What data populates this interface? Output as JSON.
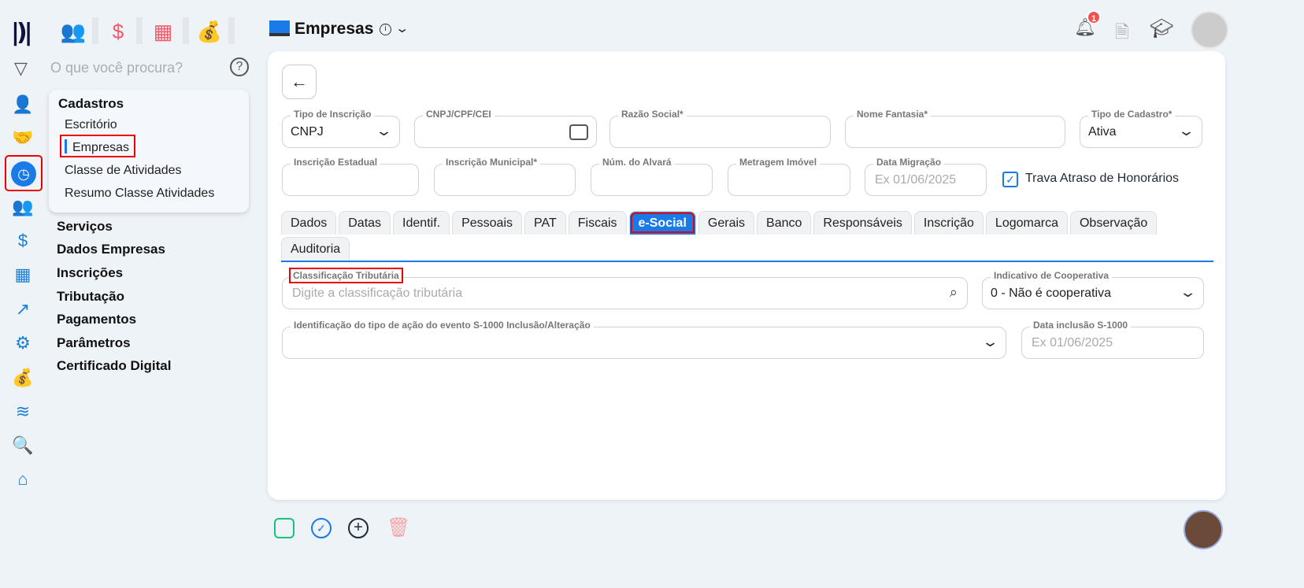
{
  "logo_text": "M",
  "top_icons": [
    "users-icon",
    "dollar-icon",
    "calculator-icon",
    "money-bag-icon"
  ],
  "search": {
    "placeholder": "O que você procura?"
  },
  "side_icons": [
    "user-gear-icon",
    "handshake-icon",
    "clock-icon",
    "users-icon",
    "dollar-circle-icon",
    "calculator-icon",
    "chart-arrow-icon",
    "gear-icon",
    "money-bag-icon",
    "layers-icon",
    "search-icon",
    "home-icon"
  ],
  "submenu": {
    "title": "Cadastros",
    "items": [
      "Escritório",
      "Empresas",
      "Classe de Atividades",
      "Resumo Classe Atividades"
    ]
  },
  "menu": [
    "Serviços",
    "Dados Empresas",
    "Inscrições",
    "Tributação",
    "Pagamentos",
    "Parâmetros",
    "Certificado Digital"
  ],
  "header": {
    "title": "Empresas",
    "notifications": "1"
  },
  "form": {
    "tipo_inscricao": {
      "label": "Tipo de Inscrição",
      "value": "CNPJ"
    },
    "cnpj": {
      "label": "CNPJ/CPF/CEI"
    },
    "razao": {
      "label": "Razão Social*"
    },
    "fantasia": {
      "label": "Nome Fantasia*"
    },
    "tipo_cadastro": {
      "label": "Tipo de Cadastro*",
      "value": "Ativa"
    },
    "insc_estadual": {
      "label": "Inscrição Estadual"
    },
    "insc_municipal": {
      "label": "Inscrição Municipal*"
    },
    "alvara": {
      "label": "Núm. do Alvará"
    },
    "metragem": {
      "label": "Metragem Imóvel"
    },
    "data_migracao": {
      "label": "Data Migração",
      "placeholder": "Ex 01/06/2025"
    },
    "trava": {
      "label": "Trava Atraso de Honorários",
      "checked": true
    }
  },
  "tabs": [
    "Dados",
    "Datas",
    "Identif.",
    "Pessoais",
    "PAT",
    "Fiscais",
    "e-Social",
    "Gerais",
    "Banco",
    "Responsáveis",
    "Inscrição",
    "Logomarca",
    "Observação",
    "Auditoria"
  ],
  "esocial": {
    "classificacao": {
      "label": "Classificação Tributária",
      "placeholder": "Digite a classificação tributária"
    },
    "cooperativa": {
      "label": "Indicativo de Cooperativa",
      "value": "0 - Não é cooperativa"
    },
    "acao": {
      "label": "Identificação do tipo de ação do evento S-1000 Inclusão/Alteração"
    },
    "data_inclusao": {
      "label": "Data inclusão S-1000",
      "placeholder": "Ex 01/06/2025"
    }
  }
}
